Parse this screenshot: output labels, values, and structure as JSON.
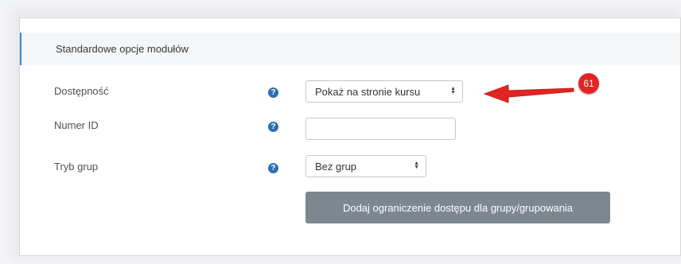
{
  "section": {
    "title": "Standardowe opcje modułów"
  },
  "fields": [
    {
      "label": "Dostępność",
      "value": "Pokaż na stronie kursu",
      "help_icon": "question-circle-icon"
    },
    {
      "label": "Numer ID",
      "value": "",
      "help_icon": "question-circle-icon"
    },
    {
      "label": "Tryb grup",
      "value": "Bez grup",
      "help_icon": "question-circle-icon"
    }
  ],
  "button": {
    "label": "Dodaj ograniczenie dostępu dla grupy/grupowania"
  },
  "annotation": {
    "badge": "61",
    "color": "#e32424"
  },
  "icons": {
    "help": "?",
    "select_arrows": "◆"
  }
}
